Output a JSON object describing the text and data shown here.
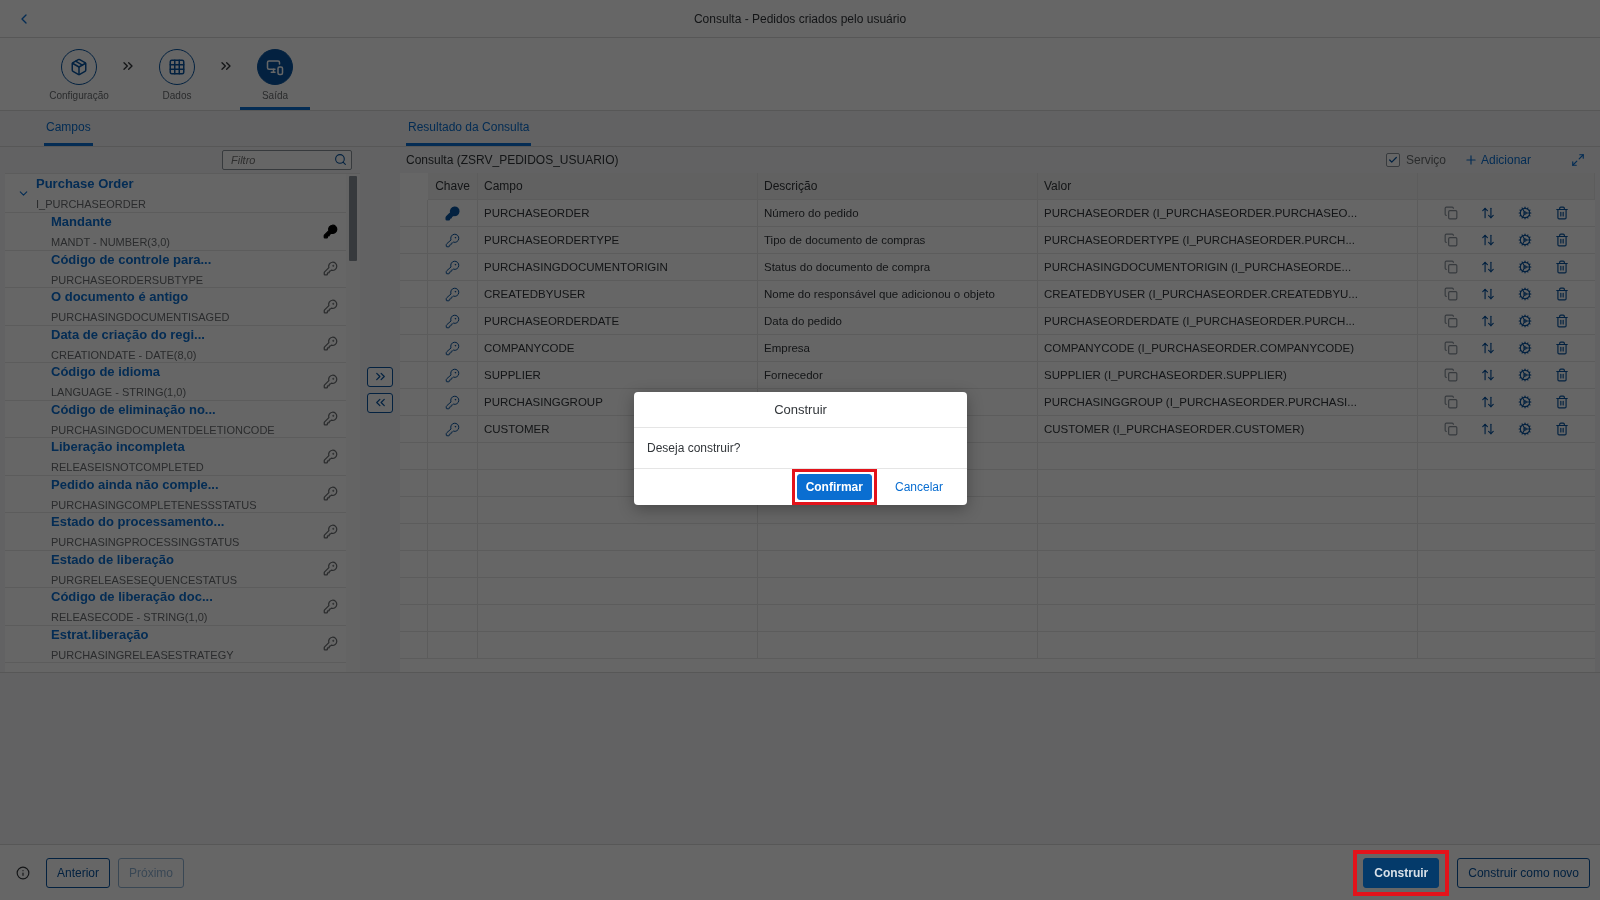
{
  "window": {
    "title": "Consulta - Pedidos criados pelo usuário"
  },
  "steps": [
    {
      "label": "Configuração",
      "kind": "config",
      "selected": false
    },
    {
      "label": "Dados",
      "kind": "data",
      "selected": false
    },
    {
      "label": "Saída",
      "kind": "output",
      "selected": true
    }
  ],
  "left_tabs": [
    {
      "label": "Campos",
      "selected": true
    }
  ],
  "right_tabs": [
    {
      "label": "Resultado da Consulta",
      "selected": true
    }
  ],
  "filter": {
    "placeholder": "Filtro"
  },
  "tree": [
    {
      "title": "Purchase Order",
      "subtitle": "I_PURCHASEORDER",
      "expanded": true,
      "children": [
        {
          "title": "Mandante",
          "subtitle": "MANDT - NUMBER(3,0)",
          "key": true
        },
        {
          "title": "Código de controle para...",
          "subtitle": "PURCHASEORDERSUBTYPE",
          "key": false
        },
        {
          "title": "O documento é antigo",
          "subtitle": "PURCHASINGDOCUMENTISAGED",
          "key": false
        },
        {
          "title": "Data de criação do regi...",
          "subtitle": "CREATIONDATE - DATE(8,0)",
          "key": false
        },
        {
          "title": "Código de idioma",
          "subtitle": "LANGUAGE - STRING(1,0)",
          "key": false
        },
        {
          "title": "Código de eliminação no...",
          "subtitle": "PURCHASINGDOCUMENTDELETIONCODE",
          "key": false
        },
        {
          "title": "Liberação incompleta",
          "subtitle": "RELEASEISNOTCOMPLETED",
          "key": false
        },
        {
          "title": "Pedido ainda não comple...",
          "subtitle": "PURCHASINGCOMPLETENESSSTATUS",
          "key": false
        },
        {
          "title": "Estado do processamento...",
          "subtitle": "PURCHASINGPROCESSINGSTATUS",
          "key": false
        },
        {
          "title": "Estado de liberação",
          "subtitle": "PURGRELEASESEQUENCESTATUS",
          "key": false
        },
        {
          "title": "Código de liberação doc...",
          "subtitle": "RELEASECODE - STRING(1,0)",
          "key": false
        },
        {
          "title": "Estrat.liberação",
          "subtitle": "PURCHASINGRELEASESTRATEGY",
          "key": false
        }
      ]
    }
  ],
  "query": {
    "title": "Consulta (ZSRV_PEDIDOS_USUARIO)",
    "service": {
      "label": "Serviço",
      "checked": true
    },
    "add_label": "Adicionar"
  },
  "table": {
    "columns": [
      "Chave",
      "Campo",
      "Descrição",
      "Valor"
    ],
    "rows": [
      {
        "key": true,
        "campo": "PURCHASEORDER",
        "descricao": "Número do pedido",
        "valor": "PURCHASEORDER (I_PURCHASEORDER.PURCHASEO..."
      },
      {
        "key": false,
        "campo": "PURCHASEORDERTYPE",
        "descricao": "Tipo de documento de compras",
        "valor": "PURCHASEORDERTYPE (I_PURCHASEORDER.PURCH..."
      },
      {
        "key": false,
        "campo": "PURCHASINGDOCUMENTORIGIN",
        "descricao": "Status do documento de compra",
        "valor": "PURCHASINGDOCUMENTORIGIN (I_PURCHASEORDE..."
      },
      {
        "key": false,
        "campo": "CREATEDBYUSER",
        "descricao": "Nome do responsável que adicionou o objeto",
        "valor": "CREATEDBYUSER (I_PURCHASEORDER.CREATEDBYU..."
      },
      {
        "key": false,
        "campo": "PURCHASEORDERDATE",
        "descricao": "Data do pedido",
        "valor": "PURCHASEORDERDATE (I_PURCHASEORDER.PURCH..."
      },
      {
        "key": false,
        "campo": "COMPANYCODE",
        "descricao": "Empresa",
        "valor": "COMPANYCODE (I_PURCHASEORDER.COMPANYCODE)"
      },
      {
        "key": false,
        "campo": "SUPPLIER",
        "descricao": "Fornecedor",
        "valor": "SUPPLIER (I_PURCHASEORDER.SUPPLIER)"
      },
      {
        "key": false,
        "campo": "PURCHASINGGROUP",
        "descricao": "",
        "valor": "PURCHASINGGROUP (I_PURCHASEORDER.PURCHASI..."
      },
      {
        "key": false,
        "campo": "CUSTOMER",
        "descricao": "",
        "valor": "CUSTOMER (I_PURCHASEORDER.CUSTOMER)"
      }
    ]
  },
  "dialog": {
    "title": "Construir",
    "message": "Deseja construir?",
    "buttons": [
      {
        "label": "Confirmar",
        "kind": "primary",
        "highlighted": true
      },
      {
        "label": "Cancelar",
        "kind": "link",
        "highlighted": false
      }
    ]
  },
  "footer": {
    "left_buttons": [
      {
        "label": "Anterior",
        "disabled": false
      },
      {
        "label": "Próximo",
        "disabled": true
      }
    ],
    "right_buttons": [
      {
        "label": "Construir",
        "kind": "primary",
        "highlighted": true
      },
      {
        "label": "Construir como novo",
        "kind": "default",
        "highlighted": false
      }
    ]
  }
}
